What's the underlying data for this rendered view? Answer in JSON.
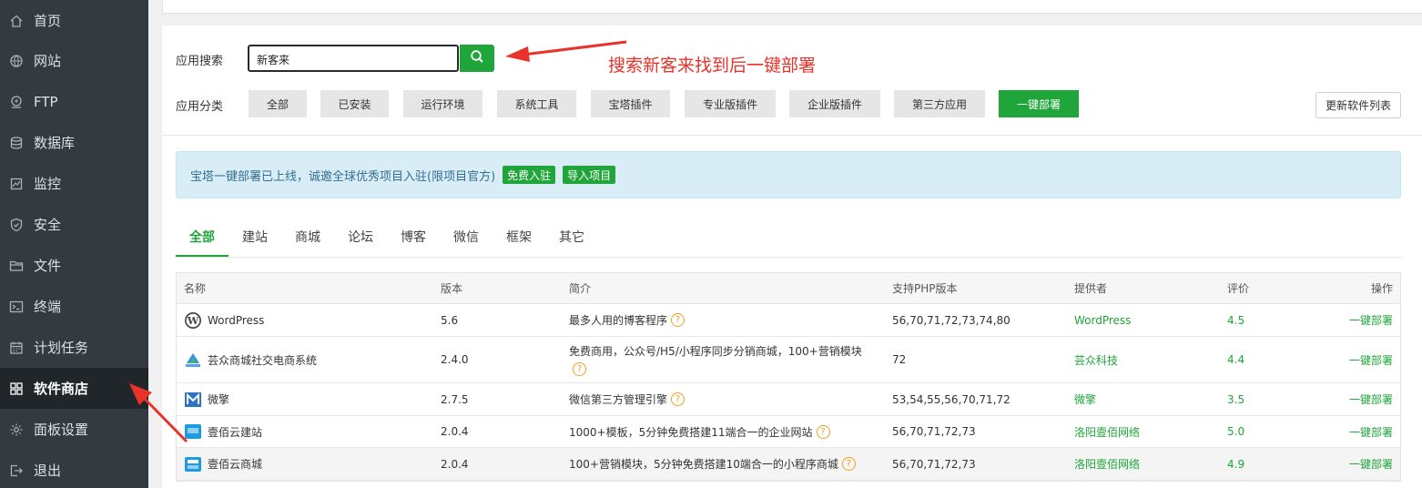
{
  "sidebar": {
    "items": [
      {
        "label": "首页",
        "icon": "home-icon"
      },
      {
        "label": "网站",
        "icon": "globe-icon"
      },
      {
        "label": "FTP",
        "icon": "ftp-icon"
      },
      {
        "label": "数据库",
        "icon": "database-icon"
      },
      {
        "label": "监控",
        "icon": "monitor-icon"
      },
      {
        "label": "安全",
        "icon": "shield-icon"
      },
      {
        "label": "文件",
        "icon": "folder-icon"
      },
      {
        "label": "终端",
        "icon": "terminal-icon"
      },
      {
        "label": "计划任务",
        "icon": "calendar-icon"
      },
      {
        "label": "软件商店",
        "icon": "apps-icon",
        "active": true
      },
      {
        "label": "面板设置",
        "icon": "gear-icon"
      },
      {
        "label": "退出",
        "icon": "logout-icon"
      }
    ]
  },
  "search": {
    "label": "应用搜索",
    "value": "新客来",
    "button_icon": "search-icon"
  },
  "annotation": {
    "text": "搜索新客来找到后一键部署",
    "color": "#e9332a"
  },
  "categories": {
    "label": "应用分类",
    "items": [
      "全部",
      "已安装",
      "运行环境",
      "系统工具",
      "宝塔插件",
      "专业版插件",
      "企业版插件",
      "第三方应用",
      "一键部署"
    ],
    "active": "一键部署",
    "refresh_label": "更新软件列表"
  },
  "notice": {
    "text": "宝塔一键部署已上线，诚邀全球优秀项目入驻(限项目官方)",
    "btn_join": "免费入驻",
    "btn_import": "导入项目"
  },
  "tabs": {
    "items": [
      "全部",
      "建站",
      "商城",
      "论坛",
      "博客",
      "微信",
      "框架",
      "其它"
    ],
    "active": "全部"
  },
  "table": {
    "headers": {
      "name": "名称",
      "version": "版本",
      "desc": "简介",
      "php": "支持PHP版本",
      "provider": "提供者",
      "rating": "评价",
      "action": "操作"
    },
    "rows": [
      {
        "name": "WordPress",
        "version": "5.6",
        "desc": "最多人用的博客程序",
        "php": "56,70,71,72,73,74,80",
        "provider": "WordPress",
        "rating": "4.5",
        "action": "一键部署",
        "icon": "wordpress-icon"
      },
      {
        "name": "芸众商城社交电商系统",
        "version": "2.4.0",
        "desc": "免费商用，公众号/H5/小程序同步分销商城，100+营销模块",
        "php": "72",
        "provider": "芸众科技",
        "rating": "4.4",
        "action": "一键部署",
        "icon": "yunzhong-icon"
      },
      {
        "name": "微擎",
        "version": "2.7.5",
        "desc": "微信第三方管理引擎",
        "php": "53,54,55,56,70,71,72",
        "provider": "微擎",
        "rating": "3.5",
        "action": "一键部署",
        "icon": "weiqing-icon"
      },
      {
        "name": "壹佰云建站",
        "version": "2.0.4",
        "desc": "1000+模板，5分钟免费搭建11端合一的企业网站",
        "php": "56,70,71,72,73",
        "provider": "洛阳壹佰网络",
        "rating": "5.0",
        "action": "一键部署",
        "icon": "yibai-site-icon"
      },
      {
        "name": "壹佰云商城",
        "version": "2.0.4",
        "desc": "100+营销模块，5分钟免费搭建10端合一的小程序商城",
        "php": "56,70,71,72,73",
        "provider": "洛阳壹佰网络",
        "rating": "4.9",
        "action": "一键部署",
        "icon": "yibai-mall-icon"
      }
    ],
    "help_glyph": "?"
  },
  "colors": {
    "sidebar_bg": "#333a40",
    "sidebar_active": "#21262b",
    "accent_green": "#20a53a",
    "annotation_red": "#e9332a",
    "notice_bg": "#d9edf7"
  }
}
